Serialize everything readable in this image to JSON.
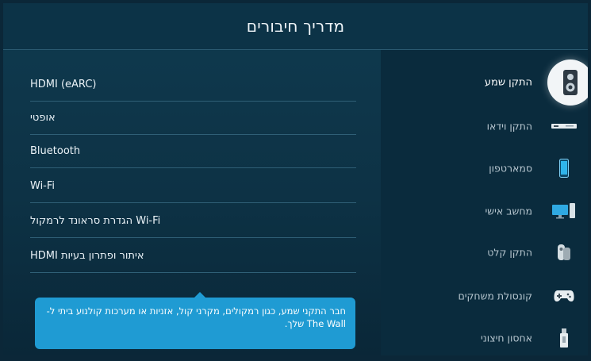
{
  "header": {
    "title": "מדריך חיבורים"
  },
  "options": [
    {
      "label": "HDMI (eARC)"
    },
    {
      "label": "אופטי"
    },
    {
      "label": "Bluetooth"
    },
    {
      "label": "Wi-Fi"
    },
    {
      "label": "Wi-Fi הגדרת סראונד לרמקול"
    },
    {
      "label": "איתור ופתרון בעיות HDMI"
    }
  ],
  "devices": [
    {
      "label": "התקן שמע",
      "icon": "speaker-icon",
      "active": true
    },
    {
      "label": "התקן וידאו",
      "icon": "video-device-icon"
    },
    {
      "label": "סמארטפון",
      "icon": "smartphone-icon"
    },
    {
      "label": "מחשב אישי",
      "icon": "pc-icon"
    },
    {
      "label": "התקן קלט",
      "icon": "input-device-icon"
    },
    {
      "label": "קונסולת משחקים",
      "icon": "gamepad-icon"
    },
    {
      "label": "אחסון חיצוני",
      "icon": "usb-storage-icon"
    }
  ],
  "tooltip": {
    "text": "חבר התקני שמע, כגון רמקולים, מקרני קול, אזניות או מערכות קולנוע ביתי ל-The Wall שלך."
  },
  "colors": {
    "accent": "#1f9bd3",
    "background": "#0d3245",
    "panel": "#0a2b3d"
  }
}
